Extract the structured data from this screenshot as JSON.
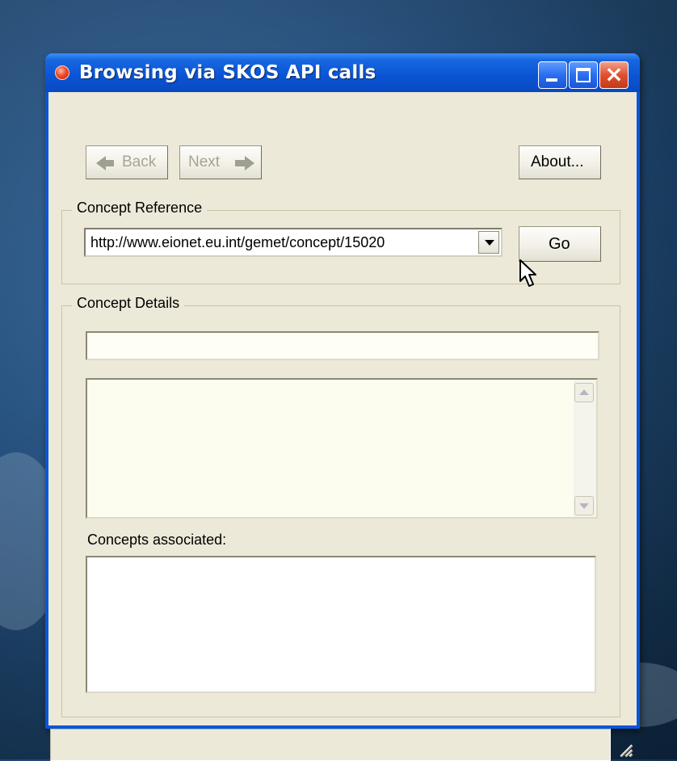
{
  "window": {
    "title": "Browsing via SKOS API calls",
    "controls": [
      "minimize",
      "maximize",
      "close"
    ]
  },
  "toolbar": {
    "back_label": "Back",
    "next_label": "Next",
    "about_label": "About..."
  },
  "concept_reference": {
    "legend": "Concept Reference",
    "combo_value": "http://www.eionet.eu.int/gemet/concept/15020",
    "go_label": "Go"
  },
  "concept_details": {
    "legend": "Concept Details",
    "title_field_value": "",
    "description_value": "",
    "associated_label": "Concepts associated:",
    "associated_items": []
  },
  "statusbar": {
    "text": ""
  },
  "colors": {
    "titlebar": "#0a54d4",
    "window_face": "#ece9d8",
    "close_button": "#e0502e",
    "field_background": "#fcfcef"
  }
}
